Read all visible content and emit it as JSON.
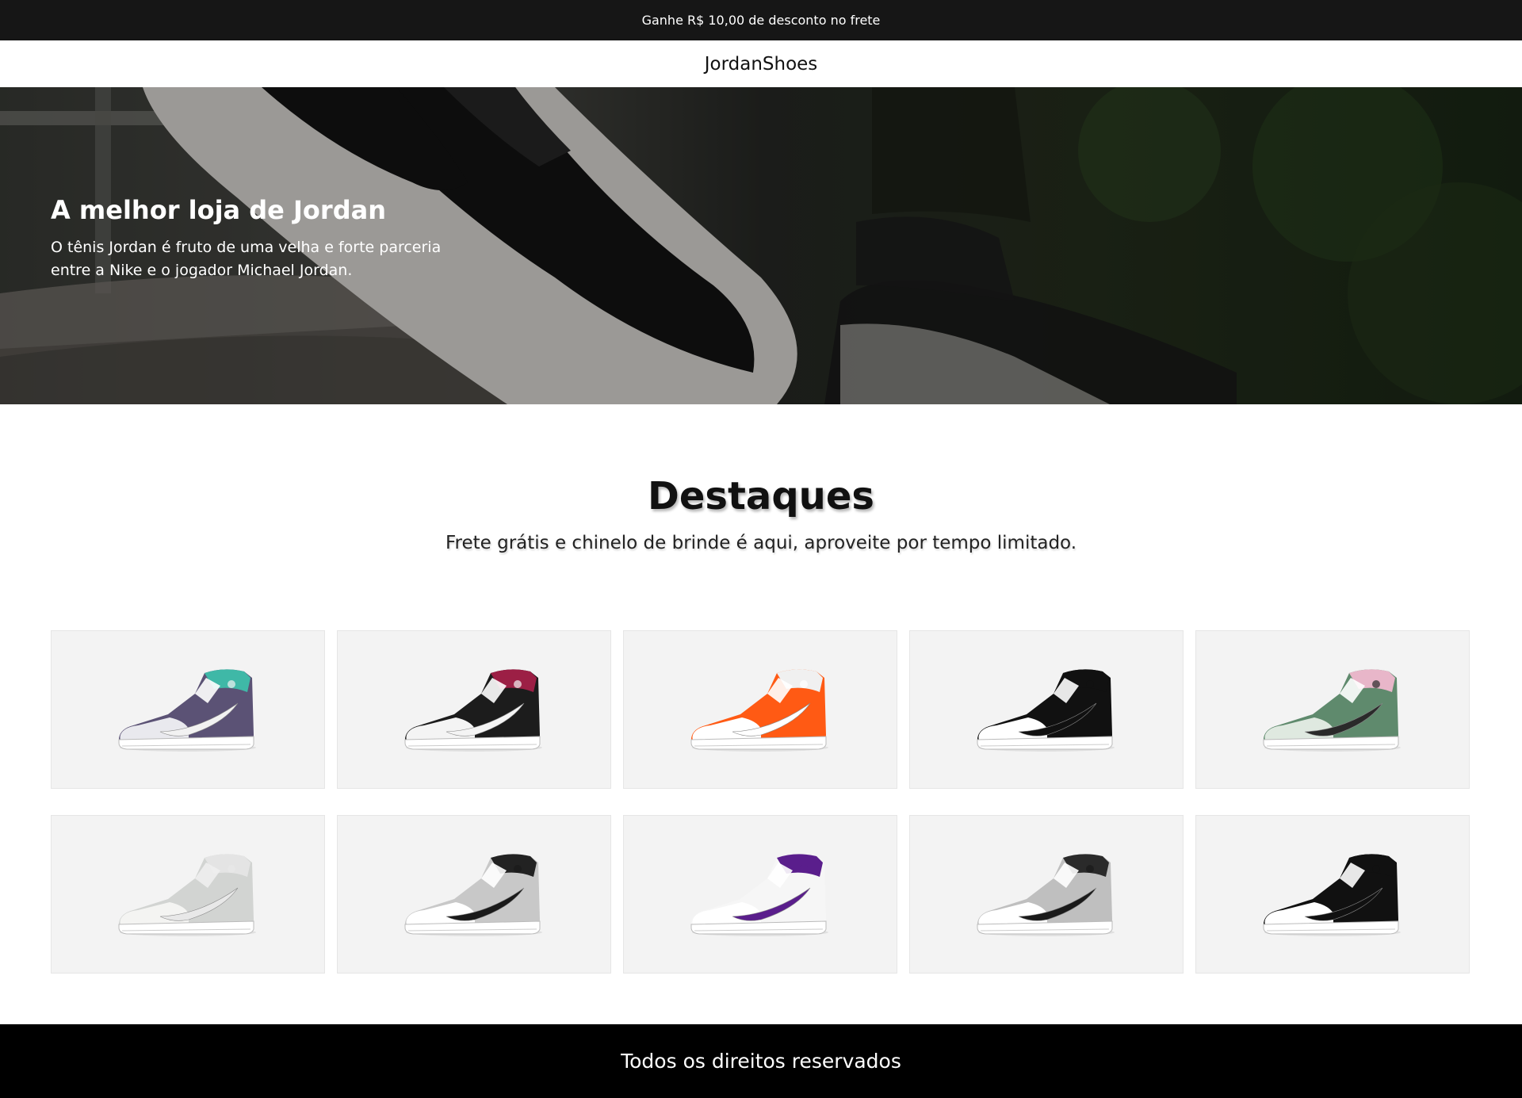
{
  "announcement": {
    "text": "Ganhe R$ 10,00 de desconto no frete"
  },
  "header": {
    "brand": "JordanShoes"
  },
  "hero": {
    "title": "A melhor loja de Jordan",
    "subtitle": "O tênis Jordan é fruto de uma velha e forte parceria entre a Nike e o jogador Michael Jordan."
  },
  "featured": {
    "title": "Destaques",
    "subtitle": "Frete grátis e chinelo de brinde é aqui, aproveite por tempo limitado."
  },
  "products": [
    {
      "name": "sneaker-purple-teal",
      "upper": "#5b5275",
      "toe": "#e9e9ee",
      "collar": "#3fb8a7",
      "swoosh": "#f2f2f2",
      "sole": "#ffffff",
      "lace": "#ffffff"
    },
    {
      "name": "sneaker-black-crimson",
      "upper": "#1c1c1c",
      "toe": "#f4f4f4",
      "collar": "#9c1f45",
      "swoosh": "#f4f4f4",
      "sole": "#ffffff",
      "lace": "#ffffff"
    },
    {
      "name": "sneaker-orange-white",
      "upper": "#ff5a14",
      "toe": "#ffffff",
      "collar": "#f0f0f0",
      "swoosh": "#ffffff",
      "sole": "#ffffff",
      "lace": "#ffffff"
    },
    {
      "name": "sneaker-black-white",
      "upper": "#111111",
      "toe": "#ffffff",
      "collar": "#111111",
      "swoosh": "#111111",
      "sole": "#ffffff",
      "lace": "#ffffff"
    },
    {
      "name": "sneaker-green-white",
      "upper": "#5f8a6d",
      "toe": "#dfe9e0",
      "collar": "#e8b6c9",
      "swoosh": "#2a2a2a",
      "sole": "#ffffff",
      "lace": "#ffffff"
    },
    {
      "name": "sneaker-white-grey",
      "upper": "#d2d4d2",
      "toe": "#f4f4f2",
      "collar": "#e4e4e4",
      "swoosh": "#e8e8e8",
      "sole": "#ffffff",
      "lace": "#eeeeee"
    },
    {
      "name": "sneaker-grey-black",
      "upper": "#c8c8c8",
      "toe": "#ffffff",
      "collar": "#222222",
      "swoosh": "#1a1a1a",
      "sole": "#ffffff",
      "lace": "#ffffff"
    },
    {
      "name": "sneaker-white-purple",
      "upper": "#f6f6f6",
      "toe": "#ffffff",
      "collar": "#5a1e8c",
      "swoosh": "#5a1e8c",
      "sole": "#ffffff",
      "lace": "#ffffff"
    },
    {
      "name": "sneaker-grey-black-2",
      "upper": "#bfbfbf",
      "toe": "#ffffff",
      "collar": "#2a2a2a",
      "swoosh": "#1a1a1a",
      "sole": "#ffffff",
      "lace": "#ffffff"
    },
    {
      "name": "sneaker-black-white-2",
      "upper": "#111111",
      "toe": "#ffffff",
      "collar": "#111111",
      "swoosh": "#111111",
      "sole": "#ffffff",
      "lace": "#ffffff"
    }
  ],
  "footer": {
    "text": "Todos os direitos reservados"
  }
}
